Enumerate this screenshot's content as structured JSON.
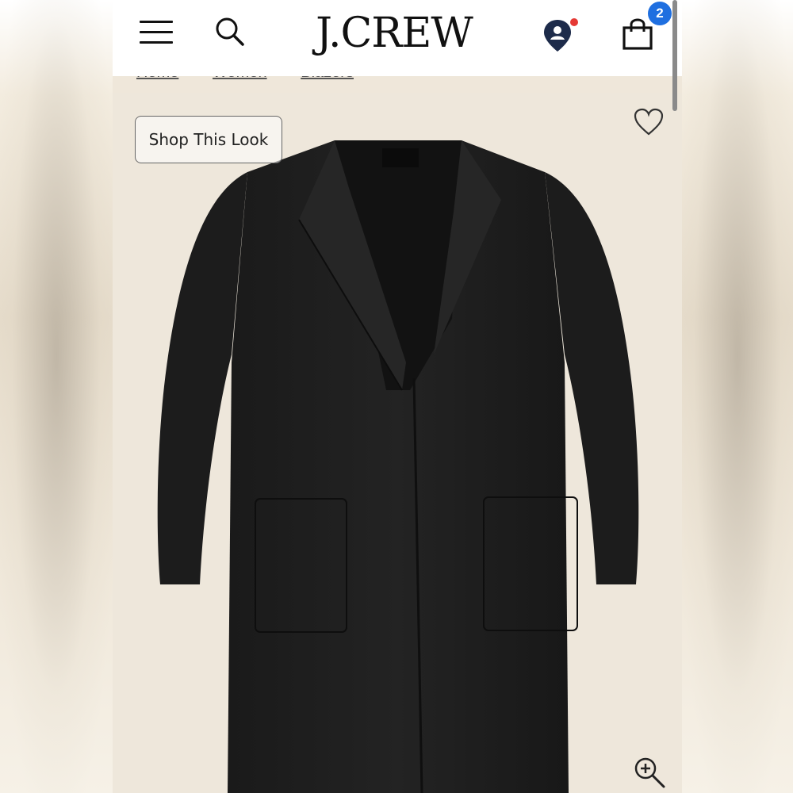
{
  "header": {
    "logo": "J.CREW",
    "bag_count": "2",
    "icons": {
      "menu": "hamburger-menu-icon",
      "search": "search-icon",
      "location": "location-pin-icon",
      "bag": "shopping-bag-icon"
    },
    "colors": {
      "badge": "#1f6fe0",
      "location_dot": "#e53935"
    }
  },
  "breadcrumb": {
    "items": [
      "Home",
      "Women",
      "Blazers"
    ],
    "separator": "›"
  },
  "product": {
    "shop_look_label": "Shop This Look",
    "icons": {
      "wishlist": "heart-icon",
      "zoom": "zoom-in-icon"
    },
    "image": "black-knit-coat",
    "background": "#eee7db"
  }
}
